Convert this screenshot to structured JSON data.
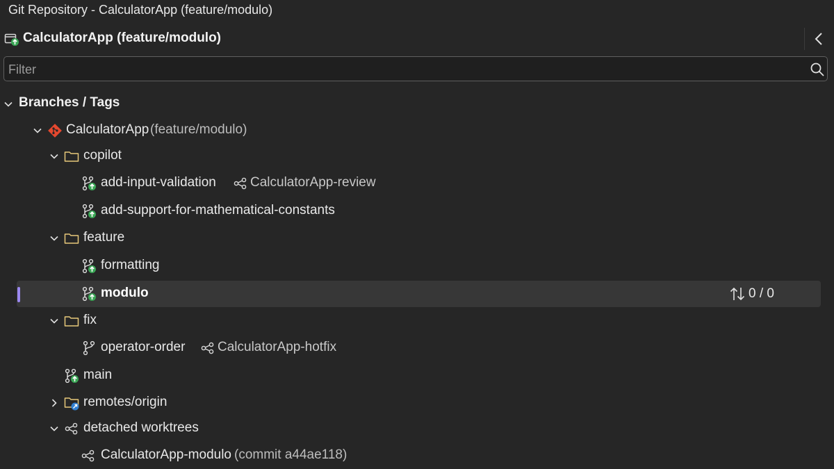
{
  "window": {
    "title": "Git Repository - CalculatorApp (feature/modulo)"
  },
  "repo": {
    "title": "CalculatorApp (feature/modulo)"
  },
  "filter": {
    "placeholder": "Filter",
    "value": ""
  },
  "section": {
    "label": "Branches / Tags"
  },
  "tree": {
    "repo_node": {
      "name": "CalculatorApp",
      "detail": "(feature/modulo)"
    },
    "copilot": {
      "label": "copilot",
      "branches": [
        {
          "name": "add-input-validation",
          "worktree": "CalculatorApp-review"
        },
        {
          "name": "add-support-for-mathematical-constants"
        }
      ]
    },
    "feature": {
      "label": "feature",
      "branches": [
        {
          "name": "formatting"
        },
        {
          "name": "modulo",
          "sync": "0 / 0"
        }
      ]
    },
    "fix": {
      "label": "fix",
      "branches": [
        {
          "name": "operator-order",
          "worktree": "CalculatorApp-hotfix"
        }
      ]
    },
    "main": {
      "label": "main"
    },
    "remotes": {
      "label": "remotes/origin"
    },
    "detached": {
      "label": "detached worktrees",
      "items": [
        {
          "name": "CalculatorApp-modulo",
          "detail": "(commit a44ae118)"
        }
      ]
    }
  },
  "colors": {
    "background": "#262626",
    "selection": "#373737",
    "selection_bar": "#9b88f0",
    "branch_up_badge": "#3aa655",
    "git_logo": "#e5482f",
    "folder": "#e7c87a",
    "remote_badge": "#2f7fd1"
  },
  "icons": {
    "repo": "repository-icon",
    "branch": "branch-icon",
    "published_branch": "published-branch-icon",
    "worktree": "worktree-icon",
    "folder": "folder-icon",
    "remote_folder": "remote-folder-icon",
    "git": "git-logo-icon",
    "sync": "incoming-outgoing-icon",
    "search": "search-icon",
    "collapse": "chevron-left-icon"
  }
}
